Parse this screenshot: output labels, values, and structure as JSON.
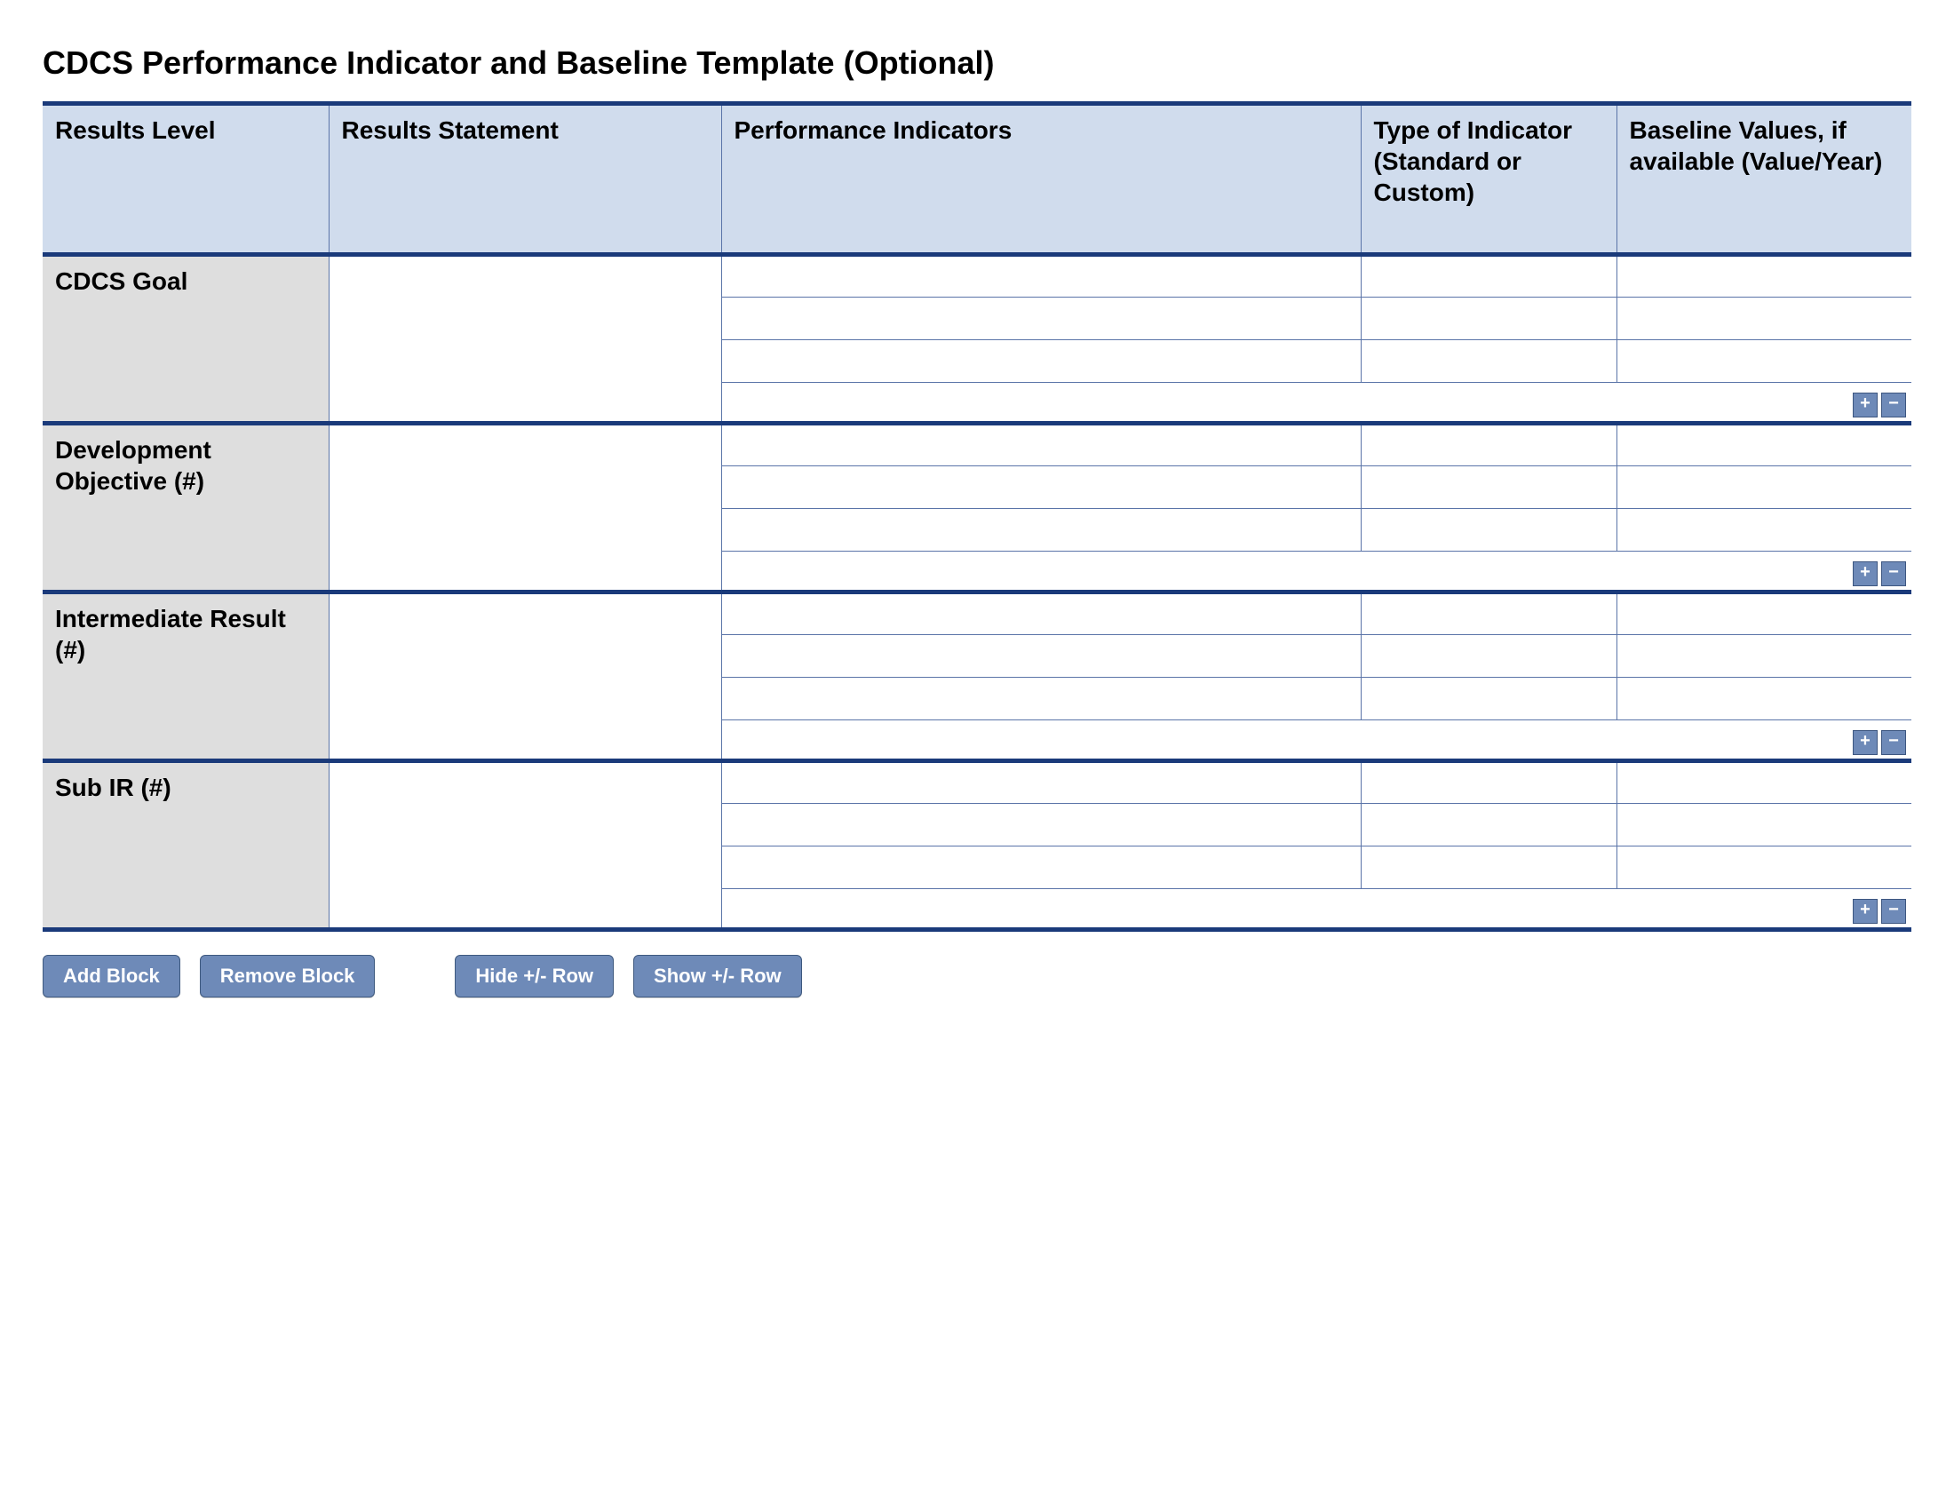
{
  "title": "CDCS Performance Indicator and Baseline Template (Optional)",
  "columns": {
    "level": "Results Level",
    "statement": "Results Statement",
    "indicators": "Performance Indicators",
    "type": "Type of Indicator (Standard or Custom)",
    "baseline": "Baseline Values, if available (Value/Year)"
  },
  "sections": [
    {
      "label": "CDCS Goal",
      "statement": "",
      "rows": [
        {
          "indicator": "",
          "type": "",
          "baseline": ""
        },
        {
          "indicator": "",
          "type": "",
          "baseline": ""
        },
        {
          "indicator": "",
          "type": "",
          "baseline": ""
        }
      ]
    },
    {
      "label": "Development Objective (#)",
      "statement": "",
      "rows": [
        {
          "indicator": "",
          "type": "",
          "baseline": ""
        },
        {
          "indicator": "",
          "type": "",
          "baseline": ""
        },
        {
          "indicator": "",
          "type": "",
          "baseline": ""
        }
      ]
    },
    {
      "label": "Intermediate Result (#)",
      "statement": "",
      "rows": [
        {
          "indicator": "",
          "type": "",
          "baseline": ""
        },
        {
          "indicator": "",
          "type": "",
          "baseline": ""
        },
        {
          "indicator": "",
          "type": "",
          "baseline": ""
        }
      ]
    },
    {
      "label": "Sub IR (#)",
      "statement": "",
      "rows": [
        {
          "indicator": "",
          "type": "",
          "baseline": ""
        },
        {
          "indicator": "",
          "type": "",
          "baseline": ""
        },
        {
          "indicator": "",
          "type": "",
          "baseline": ""
        }
      ]
    }
  ],
  "buttons": {
    "plus": "+",
    "minus": "−",
    "add_block": "Add Block",
    "remove_block": "Remove Block",
    "hide_row": "Hide +/- Row",
    "show_row": "Show +/- Row"
  }
}
